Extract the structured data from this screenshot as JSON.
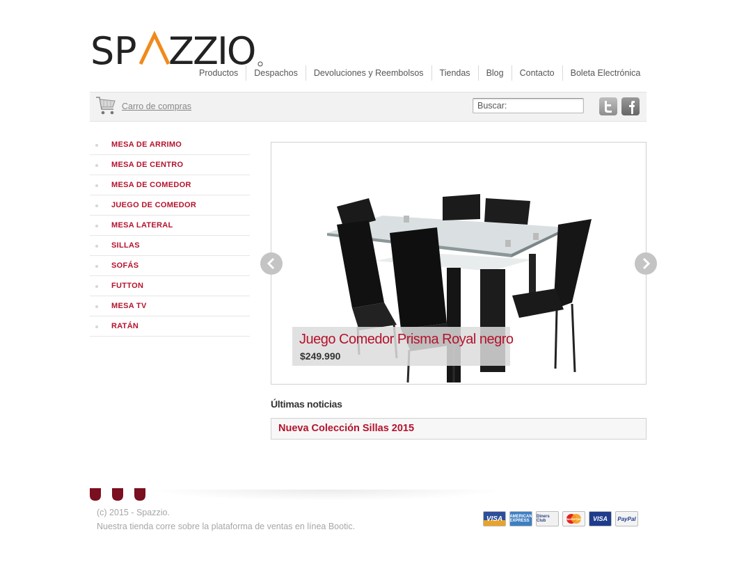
{
  "brand": {
    "logo_text": "SPAZZIO",
    "accent_color": "#f08a1c",
    "primary_color": "#b4122c"
  },
  "nav": {
    "items": [
      "Productos",
      "Despachos",
      "Devoluciones y Reembolsos",
      "Tiendas",
      "Blog",
      "Contacto",
      "Boleta Electrónica"
    ]
  },
  "toolbar": {
    "cart_label": "Carro de compras",
    "search_placeholder": "Buscar:",
    "social": [
      "twitter-icon",
      "facebook-icon"
    ]
  },
  "sidebar": {
    "categories": [
      "MESA DE ARRIMO",
      "MESA DE CENTRO",
      "MESA DE COMEDOR",
      "JUEGO DE COMEDOR",
      "MESA LATERAL",
      "SILLAS",
      "SOFÁS",
      "FUTTON",
      "MESA TV",
      "RATÁN"
    ]
  },
  "slider": {
    "title": "Juego Comedor Prisma Royal negro",
    "price": "$249.990"
  },
  "news": {
    "heading": "Últimas noticias",
    "items": [
      "Nueva Colección Sillas 2015"
    ]
  },
  "footer": {
    "copyright": "(c) 2015 - Spazzio.",
    "platform": "Nuestra tienda corre sobre la plataforma de ventas en línea Bootic.",
    "payments": [
      {
        "name": "visa-icon",
        "text": "VISA"
      },
      {
        "name": "amex-icon",
        "text": "AMERICAN EXPRESS"
      },
      {
        "name": "diners-icon",
        "text": "Diners Club"
      },
      {
        "name": "mastercard-icon",
        "text": "MasterCard"
      },
      {
        "name": "visa-debit-icon",
        "text": "VISA"
      },
      {
        "name": "paypal-icon",
        "text": "PayPal"
      }
    ]
  }
}
